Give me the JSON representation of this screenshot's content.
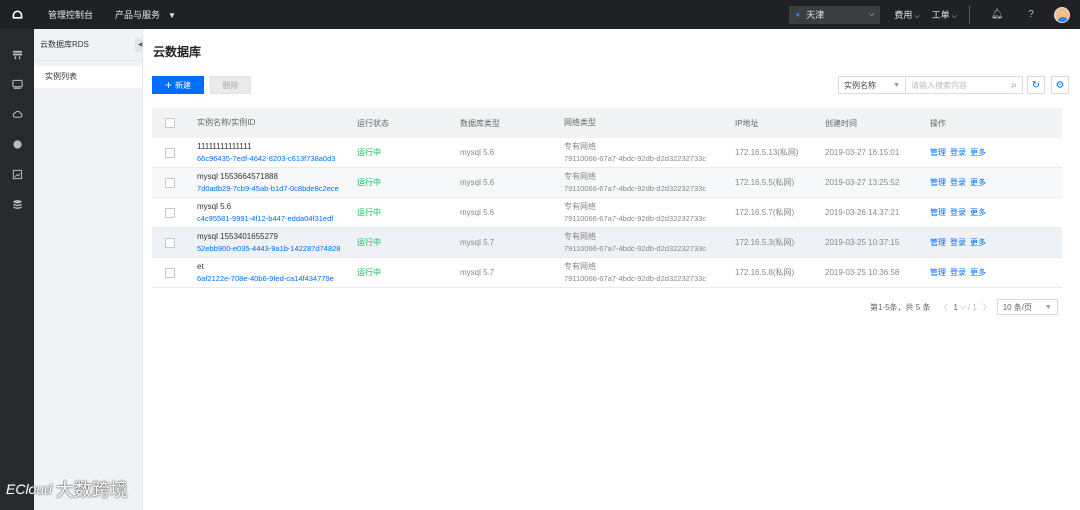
{
  "topbar": {
    "console": "管理控制台",
    "products": "产品与服务",
    "region": "天津",
    "cost": "费用",
    "ticket": "工单"
  },
  "icons": {
    "logo": "cloud-logo-icon",
    "rail": [
      "server-icon",
      "monitor-icon",
      "cloud-icon",
      "circle-icon",
      "image-icon",
      "database-icon"
    ],
    "top_bell": "bell-icon",
    "top_help": "help-icon",
    "search": "search-icon",
    "refresh": "refresh-icon",
    "settings": "gear-icon"
  },
  "sidebar": {
    "title": "云数据库RDS",
    "items": [
      {
        "label": "实例列表"
      }
    ]
  },
  "main": {
    "title": "云数据库",
    "new_button": "新建",
    "delete_button": "删除",
    "filter": {
      "select_value": "实例名称",
      "placeholder": "请输入搜索内容"
    }
  },
  "table": {
    "columns": [
      "实例名称/实例ID",
      "运行状态",
      "数据库类型",
      "网络类型",
      "IP地址",
      "创建时间",
      "操作"
    ],
    "rows": [
      {
        "name": "11111111111111",
        "id": "66c96435-7edf-4642-8203-c613f738a0d3",
        "status": "运行中",
        "db_type": "mysql 5.6",
        "net_type": "专有网络",
        "net_id": "79110066-67a7-4bdc-92db-d2d32232733c",
        "ip": "172.16.5.13(私网)",
        "created": "2019-03-27 16:15:01",
        "ops": [
          "管理",
          "登录",
          "更多"
        ]
      },
      {
        "name": "mysql 1553664571888",
        "id": "7d0adb29-7cb9-45ab-b1d7-0c8bde8c2ece",
        "status": "运行中",
        "db_type": "mysql 5.6",
        "net_type": "专有网络",
        "net_id": "79110066-67a7-4bdc-92db-d2d32232733c",
        "ip": "172.16.5.5(私网)",
        "created": "2019-03-27 13:25:52",
        "ops": [
          "管理",
          "登录",
          "更多"
        ]
      },
      {
        "name": "mysql 5.6",
        "id": "c4c95581-9991-4f12-b447-edda04f31edf",
        "status": "运行中",
        "db_type": "mysql 5.6",
        "net_type": "专有网络",
        "net_id": "79110066-67a7-4bdc-92db-d2d32232733c",
        "ip": "172.16.5.7(私网)",
        "created": "2019-03-26 14:37:21",
        "ops": [
          "管理",
          "登录",
          "更多"
        ]
      },
      {
        "name": "mysql 1553401655279",
        "id": "52ebb900-e035-4443-9a1b-142287d74828",
        "status": "运行中",
        "db_type": "mysql 5.7",
        "net_type": "专有网络",
        "net_id": "79110066-67a7-4bdc-92db-d2d32232733c",
        "ip": "172.16.5.3(私网)",
        "created": "2019-03-25 10:37:15",
        "ops": [
          "管理",
          "登录",
          "更多"
        ]
      },
      {
        "name": "et",
        "id": "6af2122e-708e-40b6-9fed-ca14f434779e",
        "status": "运行中",
        "db_type": "mysql 5.7",
        "net_type": "专有网络",
        "net_id": "79110066-67a7-4bdc-92db-d2d32232733c",
        "ip": "172.16.5.8(私网)",
        "created": "2019-03-25 10:36:58",
        "ops": [
          "管理",
          "登录",
          "更多"
        ]
      }
    ]
  },
  "pagination": {
    "summary": "第1-5条，共 5 条",
    "page": "1",
    "total_pages": "1",
    "page_size": "10 条/页"
  },
  "watermark": {
    "logo": "ECloud",
    "text": "大数跨境"
  },
  "colors": {
    "topbar": "#1f2125",
    "primary": "#006eff",
    "running": "#0abf5b"
  }
}
